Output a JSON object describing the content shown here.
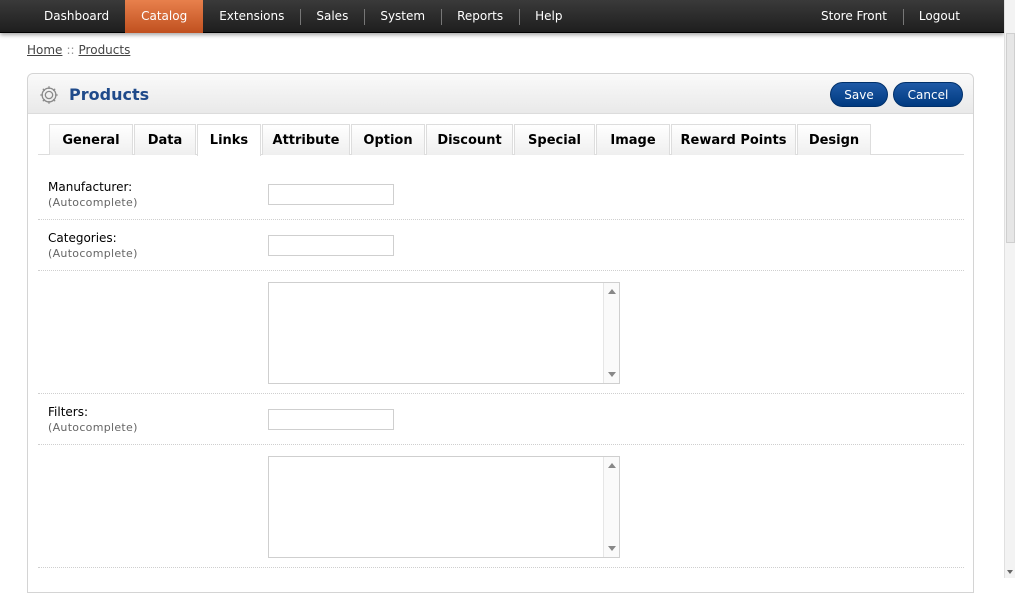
{
  "nav": {
    "left": [
      {
        "label": "Dashboard",
        "active": false
      },
      {
        "label": "Catalog",
        "active": true
      },
      {
        "label": "Extensions",
        "active": false
      },
      {
        "label": "Sales",
        "active": false
      },
      {
        "label": "System",
        "active": false
      },
      {
        "label": "Reports",
        "active": false
      },
      {
        "label": "Help",
        "active": false
      }
    ],
    "right": [
      {
        "label": "Store Front"
      },
      {
        "label": "Logout"
      }
    ]
  },
  "breadcrumb": {
    "home": "Home",
    "separator": "::",
    "current": "Products"
  },
  "panel": {
    "title": "Products",
    "icon": "gear-icon",
    "save_label": "Save",
    "cancel_label": "Cancel"
  },
  "tabs": [
    {
      "label": "General",
      "active": false
    },
    {
      "label": "Data",
      "active": false
    },
    {
      "label": "Links",
      "active": true
    },
    {
      "label": "Attribute",
      "active": false
    },
    {
      "label": "Option",
      "active": false
    },
    {
      "label": "Discount",
      "active": false
    },
    {
      "label": "Special",
      "active": false
    },
    {
      "label": "Image",
      "active": false
    },
    {
      "label": "Reward Points",
      "active": false
    },
    {
      "label": "Design",
      "active": false
    }
  ],
  "form": {
    "manufacturer": {
      "label": "Manufacturer:",
      "hint": "(Autocomplete)",
      "value": ""
    },
    "categories": {
      "label": "Categories:",
      "hint": "(Autocomplete)",
      "value": ""
    },
    "filters": {
      "label": "Filters:",
      "hint": "(Autocomplete)",
      "value": ""
    }
  },
  "colors": {
    "nav_active": "#d0632f",
    "title": "#1f4a8a",
    "button": "#003a80"
  }
}
